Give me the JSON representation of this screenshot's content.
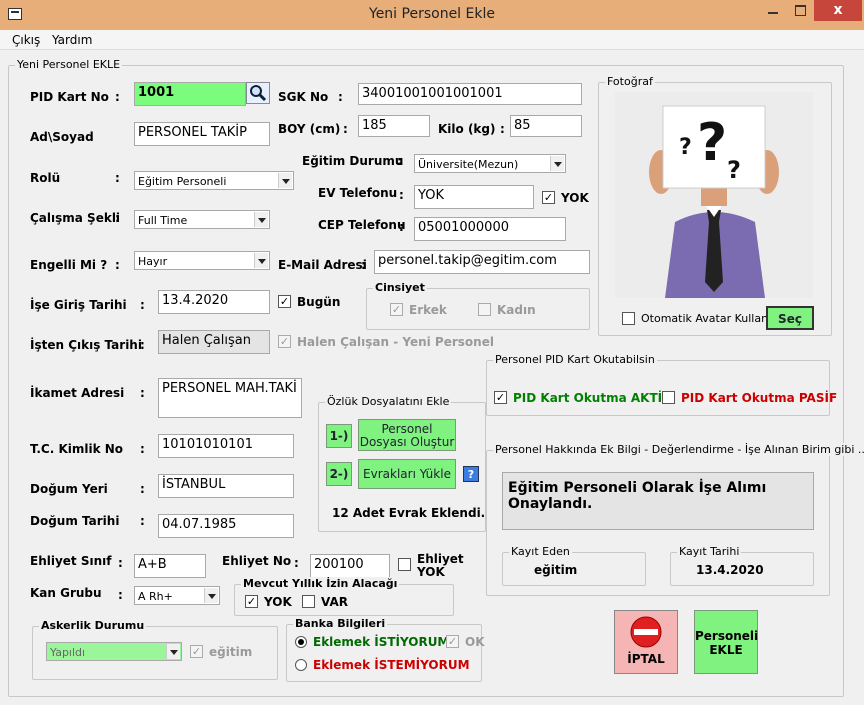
{
  "window": {
    "title": "Yeni Personel Ekle",
    "close_glyph": "x"
  },
  "menu": {
    "items": [
      "Çıkış",
      "Yardım"
    ]
  },
  "main_group": {
    "title": "Yeni Personel EKLE"
  },
  "colon": ":",
  "pid": {
    "label": "PID Kart No",
    "value": "1001"
  },
  "sgk": {
    "label": "SGK No",
    "value": "34001001001001001"
  },
  "adsoyad": {
    "label": "Ad\\Soyad",
    "value": "PERSONEL TAKİP"
  },
  "boy": {
    "label": "BOY (cm)",
    "value": "185"
  },
  "kilo": {
    "label": "Kilo (kg)",
    "value": "85"
  },
  "egitim": {
    "label": "Eğitim Durumu",
    "value": "Üniversite(Mezun)"
  },
  "rolu": {
    "label": "Rolü",
    "value": "Eğitim Personeli"
  },
  "ev_tel": {
    "label": "EV Telefonu",
    "value": "YOK",
    "checkbox_label": "YOK"
  },
  "calisma": {
    "label": "Çalışma Şekli",
    "value": "Full Time"
  },
  "cep_tel": {
    "label": "CEP Telefonu",
    "value": "05001000000"
  },
  "engelli": {
    "label": "Engelli Mi ?",
    "value": "Hayır"
  },
  "email": {
    "label": "E-Mail Adresi",
    "value": "personel.takip@egitim.com"
  },
  "ise_giris": {
    "label": "İşe Giriş Tarihi",
    "value": "13.4.2020",
    "checkbox_label": "Bugün"
  },
  "cinsiyet": {
    "title": "Cinsiyet",
    "erkek": "Erkek",
    "kadin": "Kadın"
  },
  "isten_cikis": {
    "label": "İşten Çıkış Tarihi",
    "value": "Halen Çalışan",
    "checkbox_label": "Halen Çalışan - Yeni Personel"
  },
  "ikamet": {
    "label": "İkamet Adresi",
    "value": "PERSONEL MAH.TAKİ"
  },
  "tc": {
    "label": "T.C. Kimlik No",
    "value": "10101010101"
  },
  "dogum_yeri": {
    "label": "Doğum Yeri",
    "value": "İSTANBUL"
  },
  "dogum_tarihi": {
    "label": "Doğum Tarihi",
    "value": "04.07.1985"
  },
  "ozluk": {
    "title": "Özlük Dosyalatını Ekle",
    "step1": "1-)",
    "btn1_line1": "Personel",
    "btn1_line2": "Dosyası Oluştur",
    "step2": "2-)",
    "btn2": "Evrakları Yükle",
    "help": "?",
    "status": "12 Adet Evrak Eklendi."
  },
  "ehliyet_sinif": {
    "label": "Ehliyet Sınıf",
    "value": "A+B"
  },
  "ehliyet_no": {
    "label": "Ehliyet No",
    "value": "200100",
    "checkbox_label_1": "Ehliyet",
    "checkbox_label_2": "YOK"
  },
  "kan": {
    "label": "Kan Grubu",
    "value": "A Rh+"
  },
  "izin": {
    "title": "Mevcut Yıllık İzin Alacağı",
    "yok": "YOK",
    "var": "VAR"
  },
  "askerlik": {
    "title": "Askerlik Durumu",
    "value": "Yapıldı",
    "checkbox_label": "eğitim"
  },
  "banka": {
    "title": "Banka Bilgileri",
    "opt1": "Eklemek İSTİYORUM",
    "ok": "OK",
    "opt2": "Eklemek İSTEMİYORUM"
  },
  "photo": {
    "title": "Fotoğraf",
    "checkbox_label": "Otomatik Avatar Kullan",
    "button": "Seç"
  },
  "pid_okut": {
    "title": "Personel PID Kart Okutabilsin",
    "aktif": "PID Kart Okutma AKTİF",
    "pasif": "PID Kart Okutma PASİF"
  },
  "ek_bilgi": {
    "title": "Personel Hakkında Ek Bilgi - Değerlendirme - İşe Alınan Birim gibi ...",
    "text": "Eğitim Personeli Olarak İşe Alımı Onaylandı."
  },
  "kayit_eden": {
    "title": "Kayıt Eden",
    "value": "eğitim"
  },
  "kayit_tarihi": {
    "title": "Kayıt Tarihi",
    "value": "13.4.2020"
  },
  "buttons": {
    "iptal": "İPTAL",
    "ekle_line1": "Personeli",
    "ekle_line2": "EKLE"
  },
  "colors": {
    "accent_green": "#7cfc7c",
    "titlebar": "#e7ae79",
    "close": "#c7463c",
    "aktif": "#008000",
    "pasif": "#cc0000"
  }
}
